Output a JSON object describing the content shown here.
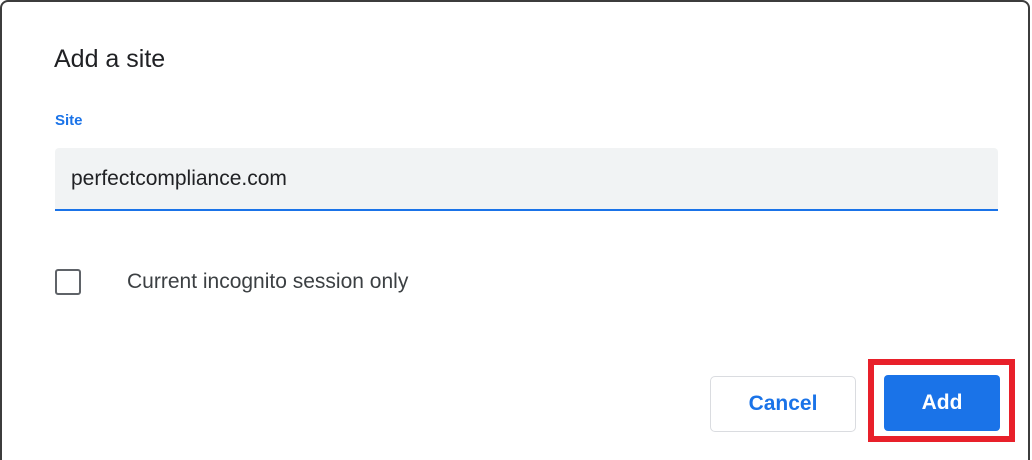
{
  "dialog": {
    "title": "Add a site",
    "site_field": {
      "label": "Site",
      "value": "perfectcompliance.com"
    },
    "incognito_option": {
      "label": "Current incognito session only",
      "checked": false
    },
    "buttons": {
      "cancel_label": "Cancel",
      "add_label": "Add"
    }
  },
  "colors": {
    "accent": "#1a73e8",
    "highlight": "#e8202a",
    "input_background": "#f1f3f4"
  }
}
